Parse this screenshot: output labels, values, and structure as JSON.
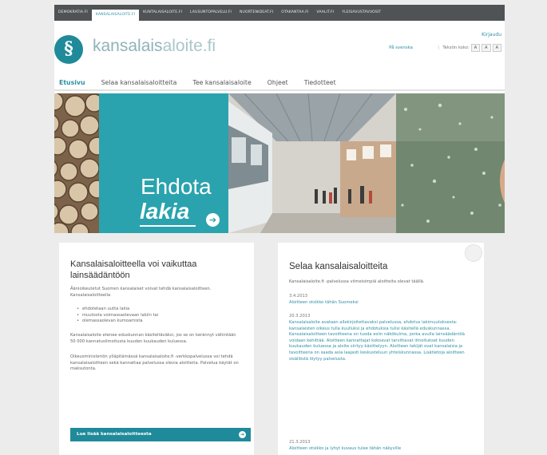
{
  "topbar": {
    "items": [
      "DEMOKRATIA.FI",
      "KANSALAISALOITE.FI",
      "KUNTALAISALOITE.FI",
      "LAUSUNTOPALVELU.FI",
      "NUORTENIDEAT.FI",
      "OTAKANTAA.FI",
      "VAALIT.FI",
      "YLEISAVUSTAVUOSIT"
    ],
    "active_index": 1
  },
  "header": {
    "logo_letter": "§",
    "logo_name": "kansalais",
    "logo_name_rest": "aloite.fi",
    "login": "Kirjaudu",
    "language": "På svenska",
    "text_size_label": "Tekstin koko:",
    "text_size_buttons": [
      "A",
      "A",
      "A"
    ]
  },
  "nav": {
    "items": [
      "Etusivu",
      "Selaa kansalaisaloitteita",
      "Tee kansalaisaloite",
      "Ohjeet",
      "Tiedotteet"
    ],
    "active_index": 0
  },
  "hero": {
    "line1": "Ehdota",
    "line2": "lakia",
    "arrow": "➔"
  },
  "left_card": {
    "title": "Kansalaisaloitteella voi vaikuttaa lainsäädäntöön",
    "intro": "Äänioikeutetut Suomen kansalaiset voivat tehdä kansalaisaloitteen. Kansalaisaloitteella",
    "bullets": [
      "ehdotetaan uutta lakia",
      "muutosta voimassaolevaan lakiin tai",
      "olemassaolevan kumoamista"
    ],
    "p2": "Kansalaisaloite etenee eduskunnan käsiteltäväksi, jos se on kerännyt vähintään 50 000 kannatusilmoitusta kuuden kuukauden kuluessa.",
    "p3": "Oikeusministeriön ylläpitämässä kansalaisaloite.fi -verkkopalvelussa voi tehdä kansalaisaloitteen sekä kannattaa palvelussa olevia aloitteita. Palvelua käytät on maksutonta.",
    "button": "Lue lisää kansalaisaloitteesta",
    "button_arrow": "➔"
  },
  "right_card": {
    "title": "Selaa kansalaisaloitteita",
    "intro": "Kansalaisaloite.fi -palvelussa viimeisimpiä aloitteita olevat täällä.",
    "items": [
      {
        "date": "3.4.2013",
        "link": "Aloitteen otsikko tähän Suomeksi"
      },
      {
        "date": "20.3.2013",
        "link": "Kansalaisaloite avataan allekirjoitettavaksi palvelussa, ehdotus lakimuutoksesta: kansalaisten oikeus tulla kuulluksi ja ehdotuksia tulisi käsitellä eduskunnassa. Kansalaisaloitteen tavoitteena on tuoda esiin näkökulma, jonka avulla lainsäädäntöä voidaan kehittää. Aloitteen kannattajat kokoavat tarvittavat ilmoitukset kuuden kuukauden kuluessa ja aloite siirtyy käsittelyyn. Aloitteen tekijät ovat kansalaisia ja tavoitteena on saada asia laajasti keskusteluun yhteiskunnassa. Lisätietoja aloitteen sisällöstä löytyy palvelusta."
      },
      {
        "date": "21.3.2013",
        "link": "Aloitteen otsikko ja lyhyt kuvaus tulee tähän näkyville"
      }
    ]
  }
}
